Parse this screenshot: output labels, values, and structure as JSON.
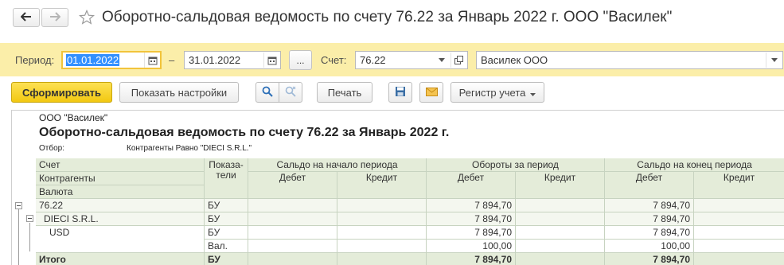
{
  "window": {
    "title": "Оборотно-сальдовая ведомость по счету 76.22 за Январь 2022 г. ООО \"Василек\""
  },
  "params": {
    "period_label": "Период:",
    "date_from": "01.01.2022",
    "dash": "–",
    "date_to": "31.01.2022",
    "ellipsis": "...",
    "account_label": "Счет:",
    "account": "76.22",
    "organization": "Василек ООО"
  },
  "toolbar": {
    "generate": "Сформировать",
    "show_settings": "Показать настройки",
    "print": "Печать",
    "register": "Регистр учета"
  },
  "report": {
    "org": "ООО \"Василек\"",
    "title": "Оборотно-сальдовая ведомость по счету 76.22 за Январь 2022 г.",
    "filter_label": "Отбор:",
    "filter_value": "Контрагенты Равно \"DIECI S.R.L.\"",
    "headers": {
      "account": "Счет",
      "counterparties": "Контрагенты",
      "currency": "Валюта",
      "indicators": "Показа-\nтели",
      "opening": "Сальдо на начало периода",
      "turnover": "Обороты за период",
      "closing": "Сальдо на конец периода",
      "debit": "Дебет",
      "credit": "Кредит"
    },
    "rows": [
      {
        "name": "76.22",
        "ind": "БУ",
        "turn_debit": "7 894,70",
        "close_debit": "7 894,70"
      },
      {
        "name": "DIECI S.R.L.",
        "ind": "БУ",
        "turn_debit": "7 894,70",
        "close_debit": "7 894,70"
      },
      {
        "name": "USD",
        "ind": "БУ",
        "turn_debit": "7 894,70",
        "close_debit": "7 894,70"
      },
      {
        "name": "",
        "ind": "Вал.",
        "turn_debit": "100,00",
        "close_debit": "100,00"
      }
    ],
    "total": {
      "name": "Итого",
      "ind": "БУ",
      "turn_debit": "7 894,70",
      "close_debit": "7 894,70"
    }
  }
}
